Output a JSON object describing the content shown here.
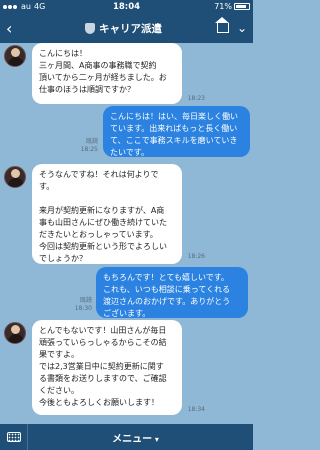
{
  "status": {
    "carrier": "au",
    "network": "4G",
    "time": "18:04",
    "battery": "71%"
  },
  "header": {
    "back_icon": "back-chevron-icon",
    "title": "キャリア派遣"
  },
  "messages": [
    {
      "dir": "in",
      "text": "こんにちは！\n三ヶ月間、A商事の事務職で契約\n頂いてから二ヶ月が経ちました。お\n仕事のほうは順調ですか？",
      "time": "18:23"
    },
    {
      "dir": "out",
      "read": "既読",
      "text": "こんにちは！はい、毎日楽しく働い\nています。出来ればもっと長く働い\nて、ここで事務スキルを磨いていき\nたいです。",
      "time": "18:25"
    },
    {
      "dir": "in",
      "text": "そうなんですね！それは何よりで\nす。\n\n来月が契約更新になりますが、A商\n事も山田さんにぜひ働き続けていた\nだきたいとおっしゃっています。\n今回は契約更新という形でよろしい\nでしょうか？",
      "time": "18:26"
    },
    {
      "dir": "out",
      "read": "既読",
      "text": "もちろんです！とても嬉しいです。\nこれも、いつも相談に乗ってくれる\n渡辺さんのおかげです。ありがとう\nございます。",
      "time": "18:30"
    },
    {
      "dir": "in",
      "text": "とんでもないです！山田さんが毎日\n頑張っていらっしゃるからこその結\n果ですよ。\nでは2,3営業日中に契約更新に関す\nる書類をお送りしますので、ご確認\nください。\n今後ともよろしくお願いします！",
      "time": "18:34"
    }
  ],
  "bottom": {
    "menu_label": "メニュー"
  }
}
